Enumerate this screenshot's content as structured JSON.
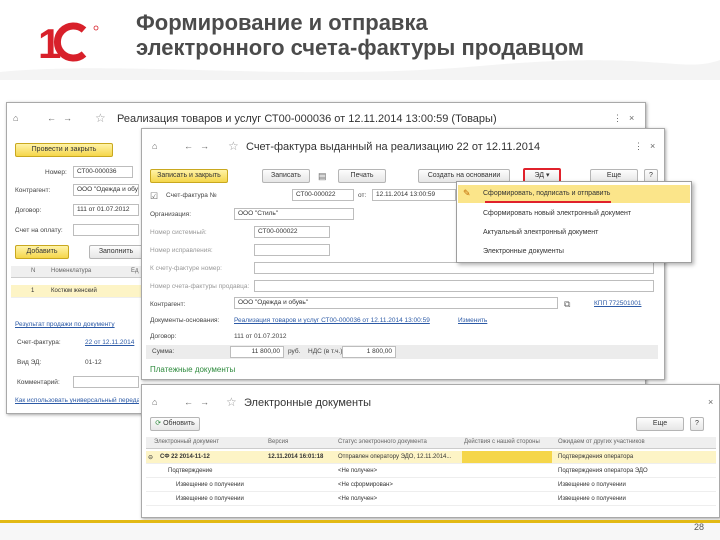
{
  "slide": {
    "title_line1": "Формирование и отправка",
    "title_line2": "электронного счета-фактуры продавцом",
    "page_number": "28",
    "accent_color": "#e2b915",
    "logo_text": "1С"
  },
  "back_window": {
    "title": "Реализация товаров и услуг СТ00-000036 от 12.11.2014 13:00:59 (Товары)",
    "post_close_button": "Провести и закрыть",
    "number_label": "Номер:",
    "number_value": "СТ00-000036",
    "counterparty_label": "Контрагент:",
    "counterparty_value": "ООО \"Одежда и обувь\"",
    "contract_label": "Договор:",
    "contract_value": "111 от 01.07.2012",
    "payment_label": "Счет на оплату:",
    "add_button": "Добавить",
    "fill_button": "Заполнить",
    "col_n": "N",
    "col_item": "Номенклатура",
    "col_unit": "Ед",
    "row_n": "1",
    "row_item": "Костюм женский",
    "link_results": "Результат продажи по документу",
    "invoice_label": "Счет-фактура:",
    "invoice_value": "22 от 12.11.2014",
    "ed_label": "Вид ЭД:",
    "ed_value": "01-12",
    "comment_label": "Комментарий:",
    "bottom_link": "Как использовать универсальный передаточный документ"
  },
  "invoice_window": {
    "title": "Счет-фактура выданный на реализацию 22 от 12.11.2014",
    "save_close_button": "Записать и закрыть",
    "save_button": "Записать",
    "print_button": "Печать",
    "create_based_button": "Создать на основании",
    "ed_button": "ЭД",
    "more_button": "Еще",
    "help_button": "?",
    "invoice_no_label": "Счет-фактура №",
    "invoice_no_value": "СТ00-000022",
    "from_label": "от:",
    "date_value": "12.11.2014 13:00:59",
    "org_label": "Организация:",
    "org_value": "ООО \"Стиль\"",
    "sys_number_label": "Номер системный:",
    "sys_number_value": "СТ00-000022",
    "correction_label": "Номер исправления:",
    "to_invoice_label": "К счету-фактуре номер:",
    "corr_invoice_label": "Номер счета-фактуры продавца:",
    "counterparty_label": "Контрагент:",
    "counterparty_value": "ООО \"Одежда и обувь\"",
    "kpp_link": "КПП 772501001",
    "base_docs_label": "Документы-основания:",
    "base_docs_link": "Реализация товаров и услуг СТ00-000036 от 12.11.2014 13:00:59",
    "change_link": "Изменить",
    "contract_label": "Договор:",
    "contract_value": "111 от 01.07.2012",
    "sum_label": "Сумма:",
    "sum_value": "11 800,00",
    "currency": "руб.",
    "vat_label": "НДС (в т.ч.):",
    "vat_value": "1 800,00",
    "payment_docs": "Платежные документы"
  },
  "ed_menu": {
    "items": [
      "Сформировать, подписать и отправить",
      "Сформировать новый электронный документ",
      "Актуальный электронный документ",
      "Электронные документы"
    ]
  },
  "ed_window": {
    "title": "Электронные документы",
    "refresh_button": "Обновить",
    "more_button": "Еще",
    "help_button": "?",
    "columns": [
      "Электронный документ",
      "Версия",
      "Статус электронного документа",
      "Действия с нашей стороны",
      "Ожидаем от других участников"
    ],
    "rows": [
      [
        "СФ 22 2014-11-12",
        "12.11.2014 16:01:18",
        "Отправлен оператору ЭДО, 12.11.2014...",
        "",
        "Подтверждения оператора"
      ],
      [
        "Подтверждение",
        "",
        "<Не получен>",
        "",
        "Подтверждения оператора ЭДО"
      ],
      [
        "Извещение о получении",
        "",
        "<Не сформирован>",
        "",
        "Извещение о получении"
      ],
      [
        "Извещение о получении",
        "",
        "<Не получен>",
        "",
        "Извещение о получении"
      ]
    ]
  }
}
